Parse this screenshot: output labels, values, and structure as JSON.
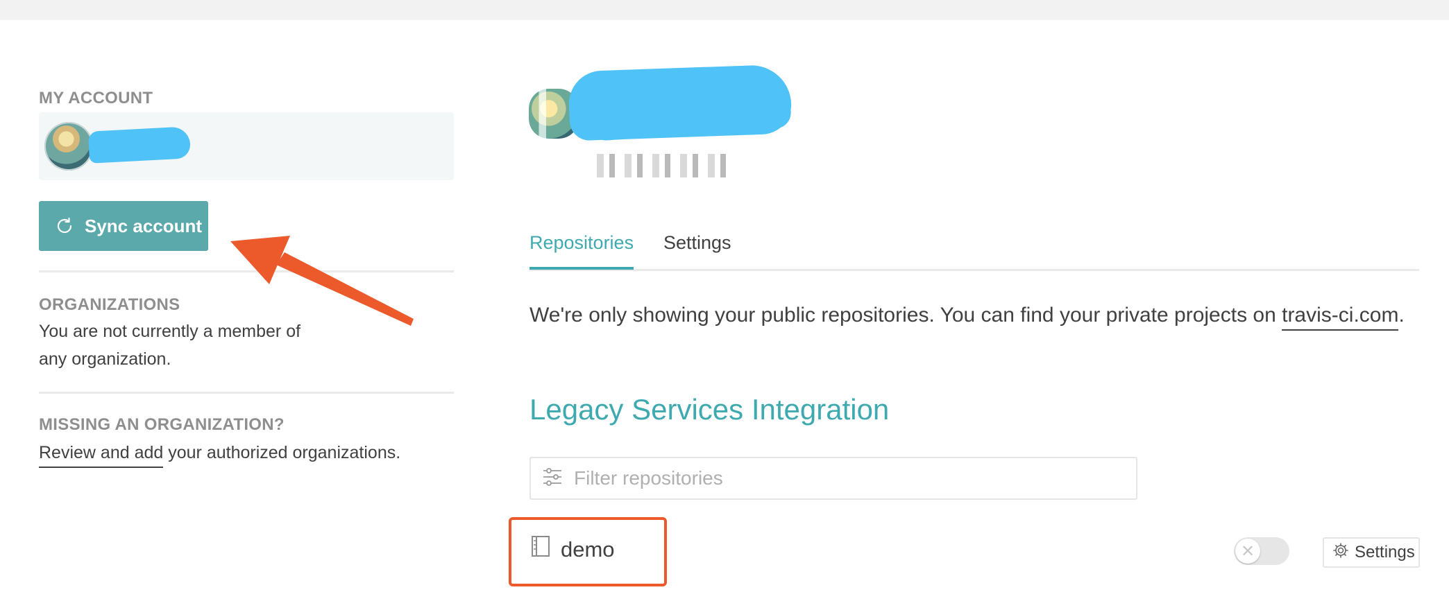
{
  "sidebar": {
    "account_heading": "MY ACCOUNT",
    "sync_button_label": "Sync account",
    "organizations_heading": "ORGANIZATIONS",
    "organizations_text_line1": "You are not currently a member of",
    "organizations_text_line2": "any organization.",
    "missing_heading": "MISSING AN ORGANIZATION?",
    "review_link": "Review and add",
    "review_rest": " your authorized organizations."
  },
  "tabs": [
    {
      "label": "Repositories",
      "active": true
    },
    {
      "label": "Settings",
      "active": false
    }
  ],
  "info": {
    "text": "We're only showing your public repositories. You can find your private projects on ",
    "link": "travis-ci.com",
    "suffix": "."
  },
  "legacy_heading": "Legacy Services Integration",
  "filter": {
    "placeholder": "Filter repositories",
    "icon": "sliders-icon"
  },
  "repositories": [
    {
      "name": "demo",
      "icon": "repo-book-icon",
      "enabled": false,
      "settings_label": "Settings"
    }
  ],
  "colors": {
    "accent": "#3eaaaf",
    "button": "#5ba9aa",
    "annotation": "#ec5a2b",
    "redaction": "#4fc3f7"
  }
}
